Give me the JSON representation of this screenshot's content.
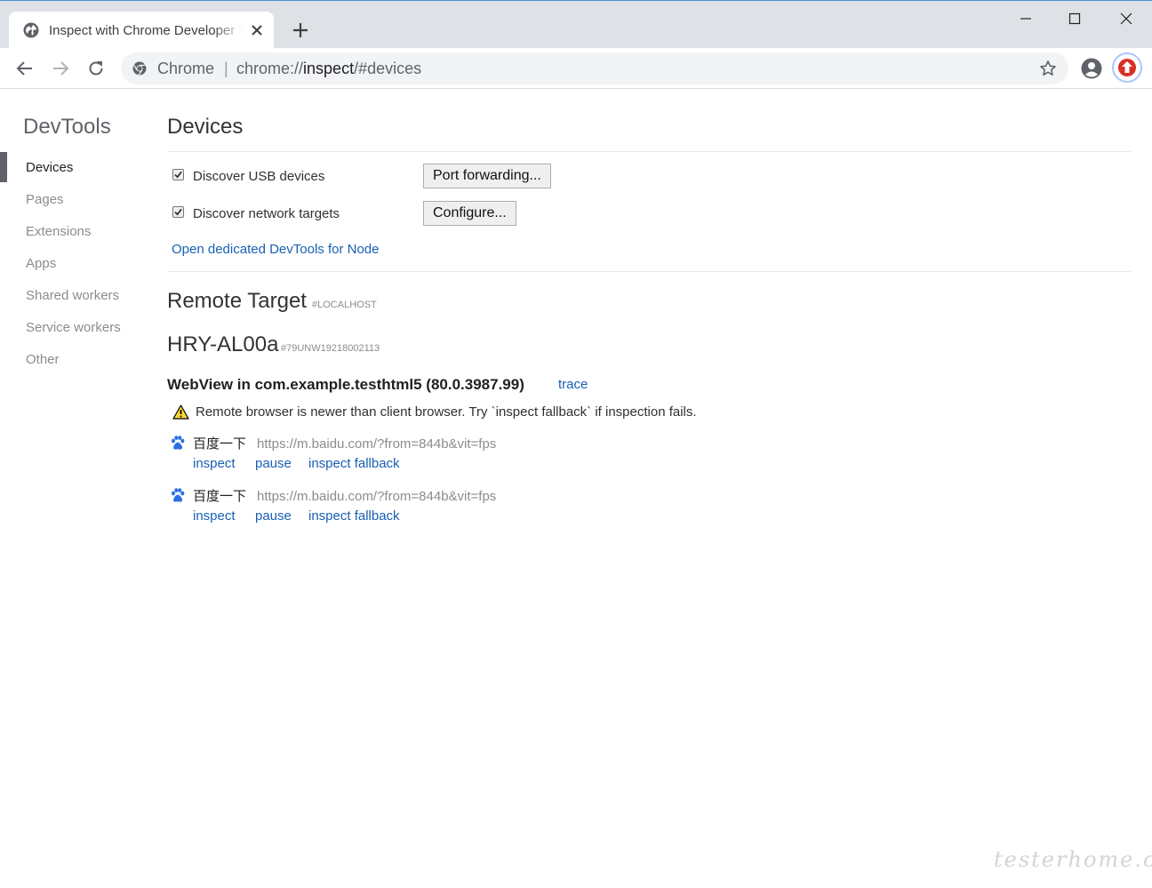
{
  "window": {
    "tab_title": "Inspect with Chrome Developer Tools",
    "colors": {
      "accent": "#1a5fb4",
      "titlebar": "#dee1e6",
      "ext_red": "#d93025"
    }
  },
  "omnibox": {
    "chip": "Chrome",
    "separator": "|",
    "url_scheme": "chrome://",
    "url_host": "inspect",
    "url_path": "/#devices"
  },
  "sidebar": {
    "title": "DevTools",
    "items": [
      {
        "label": "Devices"
      },
      {
        "label": "Pages"
      },
      {
        "label": "Extensions"
      },
      {
        "label": "Apps"
      },
      {
        "label": "Shared workers"
      },
      {
        "label": "Service workers"
      },
      {
        "label": "Other"
      }
    ]
  },
  "devices": {
    "title": "Devices",
    "discover_usb": {
      "label": "Discover USB devices",
      "checked": true
    },
    "discover_network": {
      "label": "Discover network targets",
      "checked": true
    },
    "port_forwarding_button": "Port forwarding...",
    "configure_button": "Configure...",
    "node_link": "Open dedicated DevTools for Node"
  },
  "remote_target": {
    "title": "Remote Target",
    "sub": "#LOCALHOST",
    "device_name": "HRY-AL00a",
    "device_serial": "#79UNW19218002113",
    "webview_title": "WebView in com.example.testhtml5 (80.0.3987.99)",
    "trace_link": "trace",
    "warning": "Remote browser is newer than client browser. Try `inspect fallback` if inspection fails.",
    "pages": [
      {
        "name": "百度一下",
        "url": "https://m.baidu.com/?from=844b&vit=fps",
        "actions": {
          "inspect": "inspect",
          "pause": "pause",
          "fallback": "inspect fallback"
        }
      },
      {
        "name": "百度一下",
        "url": "https://m.baidu.com/?from=844b&vit=fps",
        "actions": {
          "inspect": "inspect",
          "pause": "pause",
          "fallback": "inspect fallback"
        }
      }
    ]
  },
  "watermark": "testerhome.com"
}
